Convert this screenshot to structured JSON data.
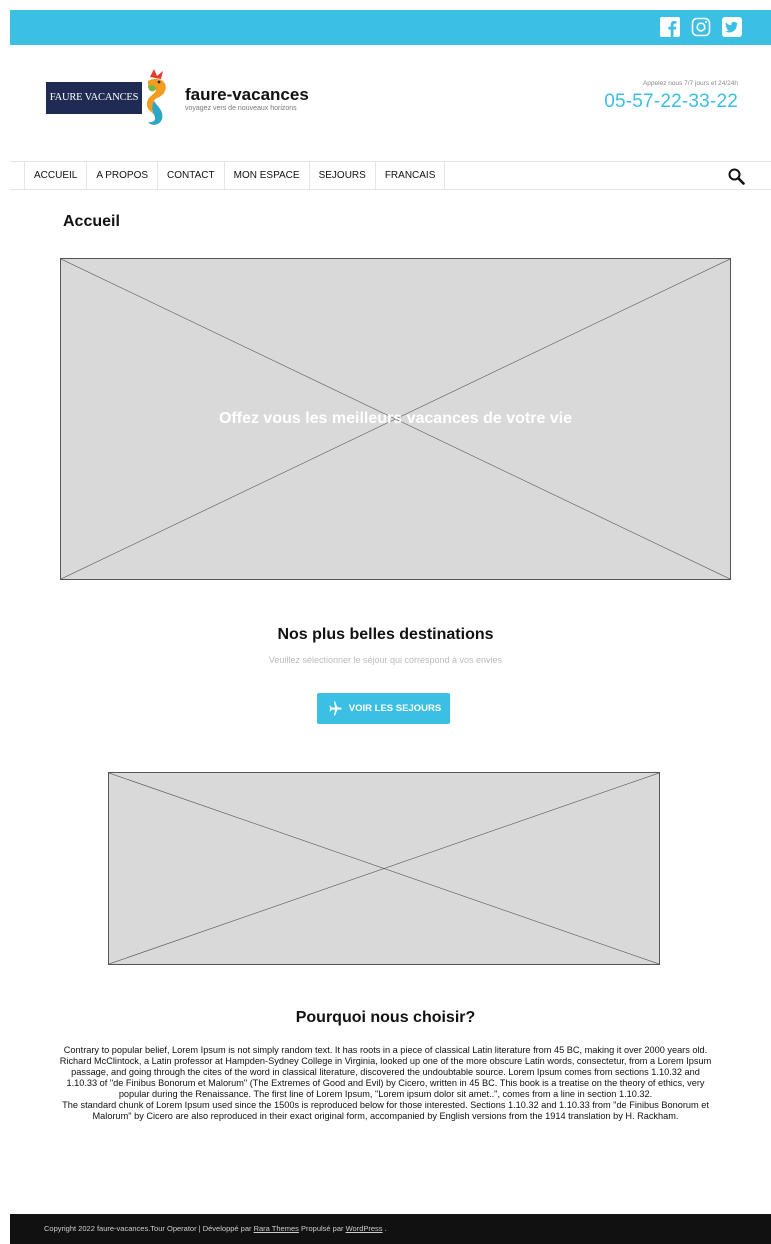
{
  "social": {
    "icons": [
      "facebook-icon",
      "instagram-icon",
      "twitter-icon"
    ]
  },
  "header": {
    "logo_text": "FAURE VACANCES",
    "brand": "faure-vacances",
    "tagline": "voyagez vers de nouveaux horizons",
    "call_label": "Appelez nous 7/7 jours et 24/24h",
    "phone": "05-57-22-33-22"
  },
  "nav": {
    "items": [
      {
        "label": "ACCUEIL"
      },
      {
        "label": "A PROPOS"
      },
      {
        "label": "CONTACT"
      },
      {
        "label": "MON ESPACE"
      },
      {
        "label": "SEJOURS"
      },
      {
        "label": "FRANCAIS"
      }
    ]
  },
  "main": {
    "page_title": "Accueil",
    "hero_text": "Offez vous les meilleurs vacances de votre vie",
    "destinations_title": "Nos plus belles destinations",
    "destinations_sub": "Veuillez sélectionner le séjour qui correspond à vos envies",
    "cta_label": "VOIR LES SEJOURS",
    "why_title": "Pourquoi nous choisir?",
    "why_p1": "Contrary to popular belief, Lorem Ipsum is not simply random text. It has roots in a piece of classical Latin literature from 45 BC, making it over 2000 years old. Richard McClintock, a Latin professor at Hampden-Sydney College in Virginia, looked up one of the more obscure Latin words, consectetur, from a Lorem Ipsum passage, and going through the cites of the word in classical literature, discovered the undoubtable source. Lorem Ipsum comes from sections 1.10.32 and 1.10.33 of \"de Finibus Bonorum et Malorum\" (The Extremes of Good and Evil) by Cicero, written in 45 BC. This book is a treatise on the theory of ethics, very popular during the Renaissance. The first line of Lorem Ipsum, \"Lorem ipsum dolor sit amet..\", comes from a line in section 1.10.32.",
    "why_p2": "The standard chunk of Lorem Ipsum used since the 1500s is reproduced below for those interested. Sections 1.10.32 and 1.10.33 from \"de Finibus Bonorum et Malorum\" by Cicero are also reproduced in their exact original form, accompanied by English versions from the 1914 translation by H. Rackham."
  },
  "footer": {
    "copyright": "Copyright 2022 faure-vacances.Tour Operator",
    "separator": " | ",
    "developed_by": "Développé par ",
    "theme_link": "Rara Themes",
    "powered_by": " Propulsé par ",
    "wp_link": "WordPress",
    "end": " ."
  },
  "colors": {
    "accent": "#3bbfe3",
    "logo_bg": "#1f2b53",
    "footer_bg": "#111111",
    "placeholder": "#d9d9d9"
  }
}
